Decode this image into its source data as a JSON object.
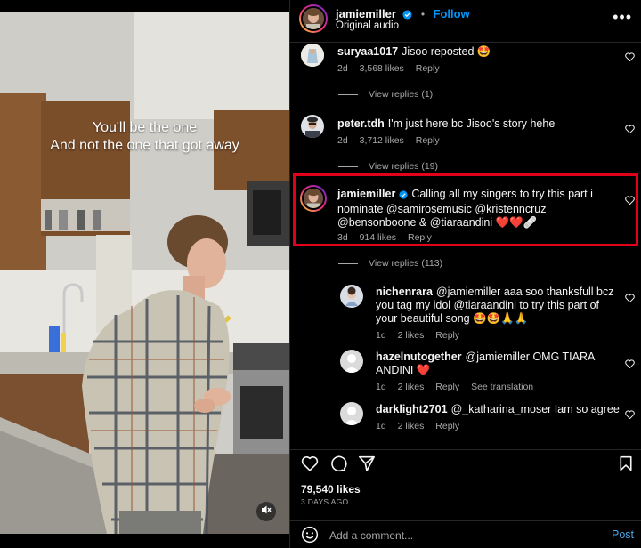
{
  "video": {
    "lyrics": [
      "You'll be the one",
      "And not the one that got away"
    ],
    "mute_icon": "speaker-muted-icon"
  },
  "post": {
    "username": "jamiemiller",
    "follow_label": "Follow",
    "separator": "•",
    "audio": "Original audio",
    "more_icon": "more-icon",
    "more_label": "•••"
  },
  "comments": [
    {
      "user": "suryaa1017",
      "text": "Jisoo reposted 🤩",
      "time": "2d",
      "likes": "3,568 likes",
      "reply": "Reply",
      "view_replies": "View replies (1)"
    },
    {
      "user": "peter.tdh",
      "text": "I'm just here bc Jisoo's story hehe",
      "time": "2d",
      "likes": "3,712 likes",
      "reply": "Reply",
      "view_replies": "View replies (19)"
    },
    {
      "user": "jamiemiller",
      "text": "Calling all my singers to try this part i nominate @samirosemusic @kristenncruz @bensonboone & @tiaraandini ❤️❤️🩹",
      "time": "3d",
      "likes": "914 likes",
      "reply": "Reply",
      "view_replies": "View replies (113)"
    }
  ],
  "replies": [
    {
      "user": "nichenrara",
      "text": "@jamiemiller aaa soo thanksfull bcz you tag my idol @tiaraandini to try this part of your beautiful song 🤩🤩🙏🙏",
      "time": "1d",
      "likes": "2 likes",
      "reply": "Reply"
    },
    {
      "user": "hazelnutogether",
      "text": "@jamiemiller OMG TIARA ANDINI ❤️",
      "time": "1d",
      "likes": "2 likes",
      "reply": "Reply",
      "translate": "See translation"
    },
    {
      "user": "darklight2701",
      "text": "@_katharina_moser Iam so agree",
      "time": "1d",
      "likes": "2 likes",
      "reply": "Reply"
    }
  ],
  "footer": {
    "likes": "79,540 likes",
    "ago": "3 DAYS AGO",
    "comment_placeholder": "Add a comment...",
    "post_label": "Post"
  },
  "colors": {
    "accent": "#0095f6",
    "highlight": "#e0001a",
    "muted": "#a8a8a8"
  }
}
